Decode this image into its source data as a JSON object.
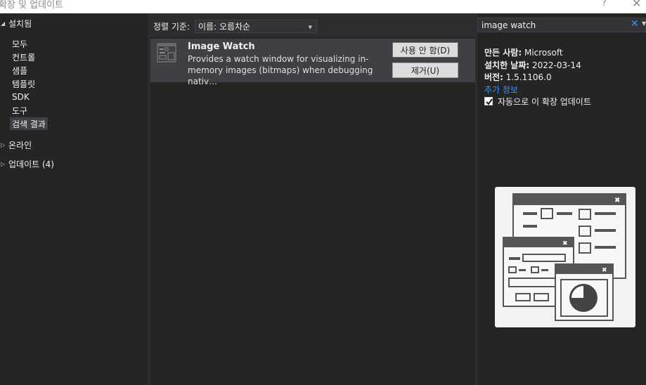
{
  "window": {
    "title": "확장 및 업데이트",
    "help": "?",
    "close": "✕"
  },
  "sidebar": {
    "installed_label": "설치됨",
    "items": [
      {
        "label": "모두"
      },
      {
        "label": "컨트롤"
      },
      {
        "label": "샘플"
      },
      {
        "label": "템플릿"
      },
      {
        "label": "SDK"
      },
      {
        "label": "도구"
      },
      {
        "label": "검색 결과",
        "selected": true
      }
    ],
    "online_label": "온라인",
    "updates_label": "업데이트 (4)"
  },
  "sort": {
    "label": "정렬 기준:",
    "value": "이름: 오름차순"
  },
  "extension": {
    "icon": "image-watch-icon",
    "name": "Image Watch",
    "desc_line1": "Provides a watch window for visualizing in-",
    "desc_line2": "memory images (bitmaps) when debugging nativ…",
    "disable_label": "사용 안 함(D)",
    "remove_label": "제거(U)"
  },
  "search": {
    "value": "image watch",
    "clear_icon": "close-icon",
    "drop_icon": "chevron-down-icon"
  },
  "details": {
    "author_label": "만든 사람:",
    "author": "Microsoft",
    "installed_date_label": "설치한 날짜:",
    "installed_date": "2022-03-14",
    "version_label": "버전:",
    "version": "1.5.1106.0",
    "more_info": "추가 정보",
    "auto_update_label": "자동으로 이 확장 업데이트",
    "auto_update_checked": true
  },
  "colors": {
    "accent": "#3794ff",
    "panel": "#252526",
    "selected": "#3f3f46"
  }
}
